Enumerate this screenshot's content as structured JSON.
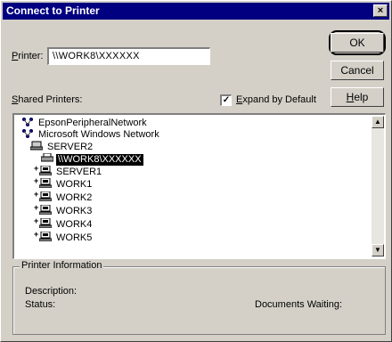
{
  "window": {
    "title": "Connect to Printer",
    "close_glyph": "×"
  },
  "printer": {
    "label_first": "P",
    "label_rest": "rinter:",
    "value": "\\\\WORK8\\XXXXXX"
  },
  "buttons": {
    "ok": "OK",
    "cancel": "Cancel",
    "help_first": "H",
    "help_rest": "elp"
  },
  "shared": {
    "label_first": "S",
    "label_rest": "hared Printers:"
  },
  "expand": {
    "checked_glyph": "✓",
    "label_first": "E",
    "label_rest": "xpand by Default"
  },
  "tree": {
    "items": [
      {
        "text": "EpsonPeripheralNetwork",
        "icon": "network-icon"
      },
      {
        "text": "Microsoft Windows Network",
        "icon": "network-icon"
      },
      {
        "text": "SERVER2",
        "icon": "server-icon"
      },
      {
        "text": "\\\\WORK8\\XXXXXX",
        "icon": "printer-icon",
        "selected": true
      },
      {
        "text": "SERVER1",
        "icon": "computer-icon"
      },
      {
        "text": "WORK1",
        "icon": "computer-icon"
      },
      {
        "text": "WORK2",
        "icon": "computer-icon"
      },
      {
        "text": "WORK3",
        "icon": "computer-icon"
      },
      {
        "text": "WORK4",
        "icon": "computer-icon"
      },
      {
        "text": "WORK5",
        "icon": "computer-icon"
      }
    ]
  },
  "scroll": {
    "up_glyph": "▲",
    "down_glyph": "▼"
  },
  "info": {
    "group_label": "Printer Information",
    "description_label": "Description:",
    "status_label": "Status:",
    "documents_label": "Documents Waiting:"
  }
}
